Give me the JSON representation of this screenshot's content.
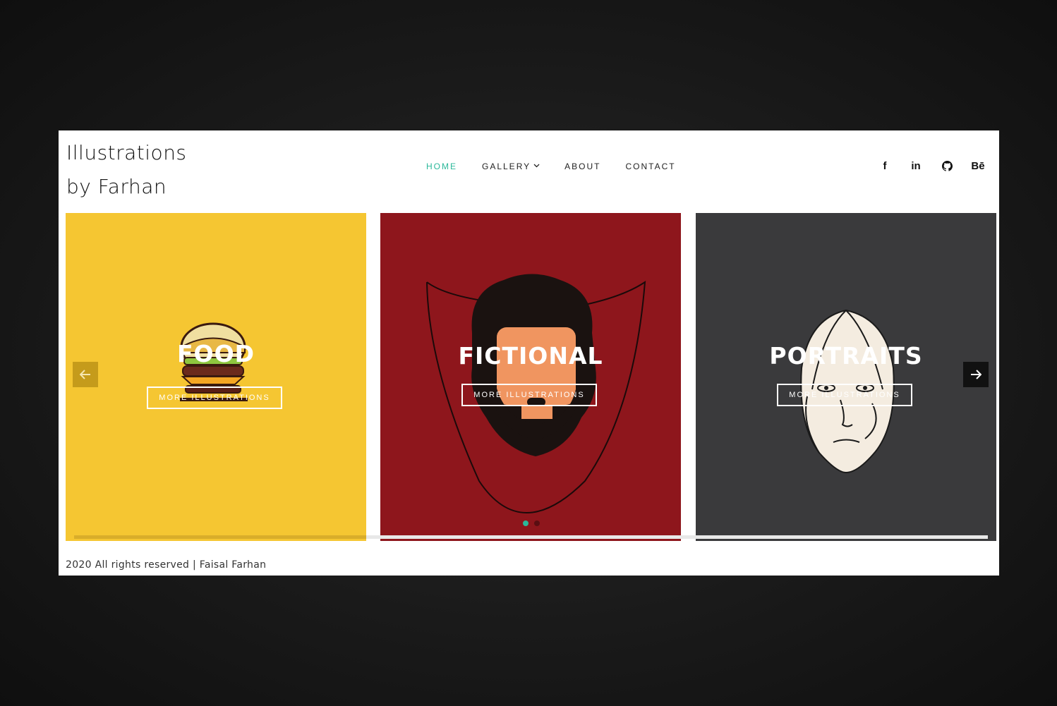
{
  "site": {
    "title_line1": "Illustrations",
    "title_line2": "by Farhan"
  },
  "nav": {
    "items": [
      {
        "label": "HOME",
        "active": true
      },
      {
        "label": "GALLERY",
        "active": false,
        "dropdown": true
      },
      {
        "label": "ABOUT",
        "active": false
      },
      {
        "label": "CONTACT",
        "active": false
      }
    ],
    "gallery_chevron": "chevron-down-icon"
  },
  "social": {
    "facebook": "f",
    "linkedin": "in",
    "github": "github-icon",
    "behance": "Bē"
  },
  "slider": {
    "cards": [
      {
        "title": "FOOD",
        "button": "MORE ILLUSTRATIONS",
        "bg": "#f5c632"
      },
      {
        "title": "FICTIONAL",
        "button": "MORE ILLUSTRATIONS",
        "bg": "#8e161c"
      },
      {
        "title": "PORTRAITS",
        "button": "MORE ILLUSTRATIONS",
        "bg": "#3a3a3c"
      }
    ],
    "prev_icon": "arrow-left-icon",
    "next_icon": "arrow-right-icon",
    "dots": [
      {
        "active": true,
        "color": "#2bb89a"
      },
      {
        "active": false,
        "color": "#5a0e12"
      }
    ],
    "progress": 0.32
  },
  "footer": {
    "text": "2020 All rights reserved | Faisal Farhan"
  }
}
